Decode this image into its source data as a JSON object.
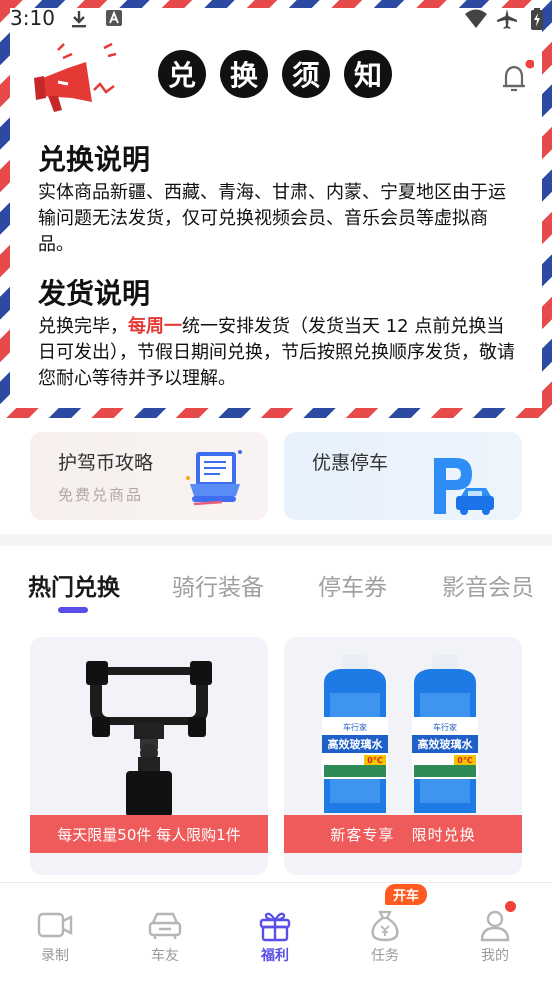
{
  "status_bar": {
    "time": "3:10"
  },
  "notice": {
    "title_chars": [
      "兑",
      "换",
      "须",
      "知"
    ],
    "sections": [
      {
        "heading": "兑换说明",
        "body": "实体商品新疆、西藏、青海、甘肃、内蒙、宁夏地区由于运输问题无法发货，仅可兑换视频会员、音乐会员等虚拟商品。"
      },
      {
        "heading": "发货说明",
        "body_before": "兑换完毕，",
        "body_highlight": "每周一",
        "body_after": "统一安排发货（发货当天 12 点前兑换当日可发出），节假日期间兑换，节后按照兑换顺序发货，敬请您耐心等待并予以理解。"
      }
    ]
  },
  "cards": {
    "guide": {
      "title": "护驾币攻略",
      "subtitle": "免费兑商品"
    },
    "parking": {
      "title": "优惠停车"
    }
  },
  "tabs": [
    {
      "label": "热门兑换",
      "active": true
    },
    {
      "label": "骑行装备",
      "active": false
    },
    {
      "label": "停车券",
      "active": false
    },
    {
      "label": "影音会员",
      "active": false
    }
  ],
  "products": [
    {
      "banner": "每天限量50件 每人限购1件",
      "image": "phone-mount-icon"
    },
    {
      "banner": "新客专享   限时兑换",
      "image": "washer-fluid-bottles-icon",
      "bottle_brand": "车行家",
      "bottle_label": "高效玻璃水",
      "bottle_temp": "0°C"
    }
  ],
  "bottom_nav": {
    "items": [
      {
        "label": "录制",
        "icon": "camera-icon",
        "active": false
      },
      {
        "label": "车友",
        "icon": "car-icon",
        "active": false
      },
      {
        "label": "福利",
        "icon": "gift-icon",
        "active": true
      },
      {
        "label": "任务",
        "icon": "money-bag-icon",
        "active": false
      },
      {
        "label": "我的",
        "icon": "user-icon",
        "active": false
      }
    ],
    "task_badge": "开车"
  },
  "colors": {
    "accent": "#5a4ee8",
    "red": "#e53935",
    "banner_red": "#ef5a5a",
    "badge_orange": "#ff5a1f",
    "airmail_blue": "#2d4aa3"
  }
}
